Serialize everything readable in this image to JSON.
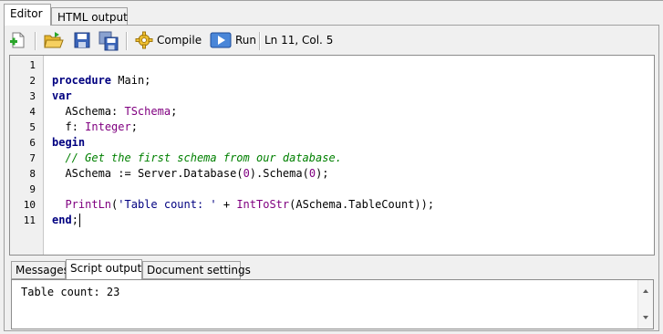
{
  "tabs": [
    "Editor",
    "HTML output"
  ],
  "toolbar": {
    "new_icon": "new-file-icon",
    "open_icon": "open-folder-icon",
    "save_icon": "save-icon",
    "save_all_icon": "save-all-icon",
    "compile_label": "Compile",
    "compile_icon": "gear-icon",
    "run_label": "Run",
    "run_icon": "play-icon",
    "cursor_position": "Ln 11, Col. 5"
  },
  "editor": {
    "line_numbers": [
      "1",
      "2",
      "3",
      "4",
      "5",
      "6",
      "7",
      "8",
      "9",
      "10",
      "11"
    ],
    "lines": [
      "",
      "procedure Main;",
      "var",
      "  ASchema: TSchema;",
      "  f: Integer;",
      "begin",
      "  // Get the first schema from our database.",
      "  ASchema := Server.Database(0).Schema(0);",
      "",
      "  PrintLn('Table count: ' + IntToStr(ASchema.TableCount));",
      "end;"
    ]
  },
  "bottom_tabs": [
    "Messages",
    "Script output",
    "Document settings"
  ],
  "output": {
    "text": "Table count: 23"
  },
  "colors": {
    "keyword": "#000080",
    "type": "#800080",
    "comment": "#008000",
    "number": "#800080"
  }
}
